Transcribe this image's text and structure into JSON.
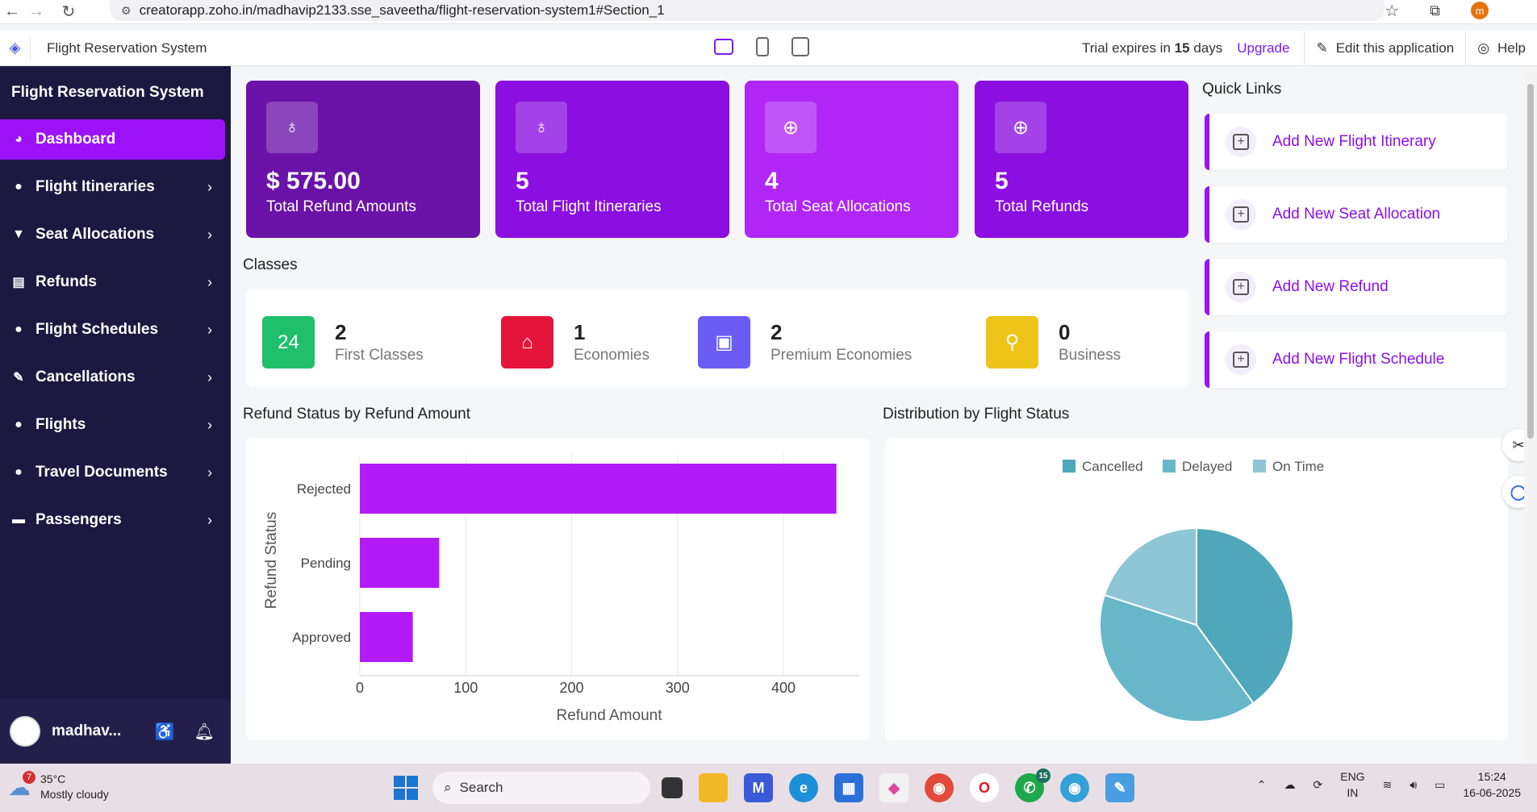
{
  "browser": {
    "url": "creatorapp.zoho.in/madhavip2133.sse_saveetha/flight-reservation-system1#Section_1",
    "profile_initial": "m"
  },
  "header": {
    "app_name": "Flight Reservation System",
    "trial_prefix": "Trial expires in",
    "trial_days": "15",
    "trial_suffix": "days",
    "upgrade": "Upgrade",
    "edit_app": "Edit this application",
    "help": "Help"
  },
  "sidebar": {
    "title": "Flight Reservation System",
    "items": [
      {
        "label": "Dashboard",
        "icon": "dashboard-icon",
        "active": true
      },
      {
        "label": "Flight Itineraries",
        "icon": "globe-icon"
      },
      {
        "label": "Seat Allocations",
        "icon": "cup-icon"
      },
      {
        "label": "Refunds",
        "icon": "receipt-icon"
      },
      {
        "label": "Flight Schedules",
        "icon": "globe-icon"
      },
      {
        "label": "Cancellations",
        "icon": "tools-icon"
      },
      {
        "label": "Flights",
        "icon": "globe-icon"
      },
      {
        "label": "Travel Documents",
        "icon": "globe-icon"
      },
      {
        "label": "Passengers",
        "icon": "card-icon"
      }
    ],
    "user": "madhav..."
  },
  "stats": [
    {
      "value": "$ 575.00",
      "label": "Total Refund Amounts",
      "color": "#6b12a8",
      "icon": "money-bag-icon"
    },
    {
      "value": "5",
      "label": "Total Flight Itineraries",
      "color": "#8a0fe0",
      "icon": "globe-stand-icon"
    },
    {
      "value": "4",
      "label": "Total Seat Allocations",
      "color": "#b026f7",
      "icon": "globe-icon"
    },
    {
      "value": "5",
      "label": "Total Refunds",
      "color": "#8a0fe0",
      "icon": "globe-icon"
    }
  ],
  "classes": {
    "title": "Classes",
    "items": [
      {
        "count": "2",
        "label": "First Classes",
        "color": "#1fbf6c",
        "icon": "24h-icon"
      },
      {
        "count": "1",
        "label": "Economies",
        "color": "#e5143a",
        "icon": "store-icon"
      },
      {
        "count": "2",
        "label": "Premium Economies",
        "color": "#6a5cf5",
        "icon": "presentation-icon"
      },
      {
        "count": "0",
        "label": "Business",
        "color": "#efc41a",
        "icon": "tie-icon"
      }
    ]
  },
  "quick_links": {
    "title": "Quick Links",
    "items": [
      "Add New Flight Itinerary",
      "Add New Seat Allocation",
      "Add New Refund",
      "Add New Flight Schedule"
    ]
  },
  "refund_chart_title": "Refund Status by Refund Amount",
  "distribution_chart_title": "Distribution by Flight Status",
  "chart_data": [
    {
      "type": "bar",
      "orientation": "horizontal",
      "categories": [
        "Rejected",
        "Pending",
        "Approved"
      ],
      "values": [
        450,
        75,
        50
      ],
      "xlabel": "Refund Amount",
      "ylabel": "Refund Status",
      "xlim": [
        0,
        470
      ],
      "xticks": [
        0,
        100,
        200,
        300,
        400
      ],
      "color": "#b31af8",
      "grid": true
    },
    {
      "type": "pie",
      "categories": [
        "Cancelled",
        "Delayed",
        "On Time"
      ],
      "values": [
        2,
        2,
        1
      ],
      "colors": [
        "#4ea7bb",
        "#67b7c9",
        "#8ec6d6"
      ],
      "legend": "top"
    }
  ],
  "taskbar": {
    "weather_temp": "35°C",
    "weather_desc": "Mostly cloudy",
    "weather_badge": "7",
    "search": "Search",
    "whatsapp_badge": "15",
    "lang1": "ENG",
    "lang2": "IN",
    "time": "15:24",
    "date": "16-06-2025"
  }
}
